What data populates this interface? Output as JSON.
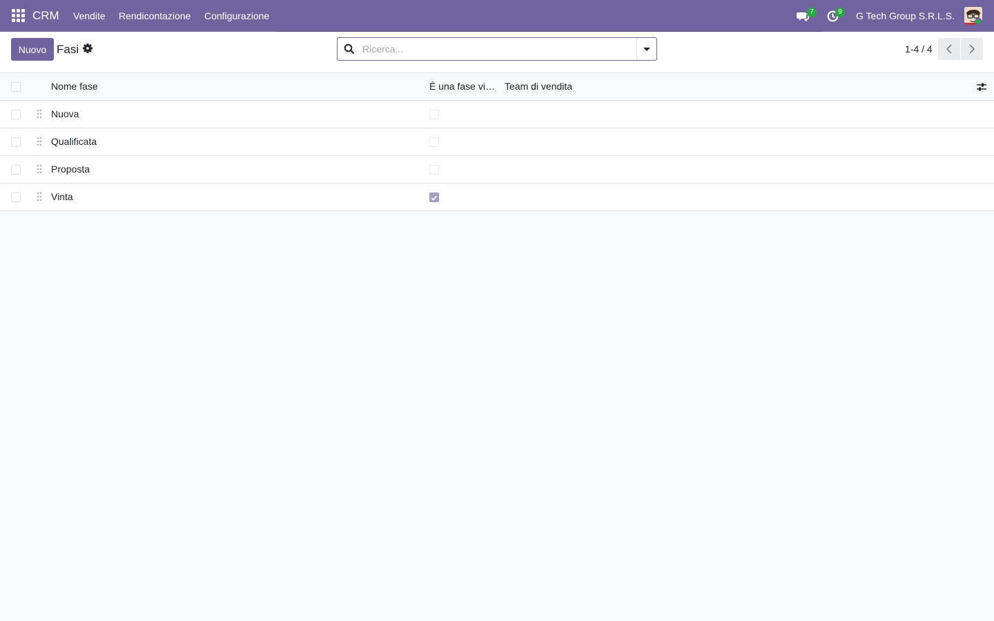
{
  "navbar": {
    "app_name": "CRM",
    "menu": [
      "Vendite",
      "Rendicontazione",
      "Configurazione"
    ],
    "messages_count": "7",
    "activities_count": "9",
    "company": "G Tech Group S.R.L.S.",
    "colors": {
      "primary": "#71639e",
      "badge": "#28a745"
    }
  },
  "control_panel": {
    "new_button": "Nuovo",
    "title": "Fasi",
    "search_placeholder": "Ricerca...",
    "pager": "1-4 / 4"
  },
  "table": {
    "columns": [
      "Nome fase",
      "È una fase vi…",
      "Team di vendita"
    ],
    "rows": [
      {
        "name": "Nuova",
        "is_won": false,
        "team": ""
      },
      {
        "name": "Qualificata",
        "is_won": false,
        "team": ""
      },
      {
        "name": "Proposta",
        "is_won": false,
        "team": ""
      },
      {
        "name": "Vinta",
        "is_won": true,
        "team": ""
      }
    ]
  },
  "icons": [
    "apps-grid-icon",
    "chat-icon",
    "clock-icon",
    "gear-icon",
    "search-icon",
    "caret-down-icon",
    "chevron-left-icon",
    "chevron-right-icon",
    "sliders-icon",
    "drag-handle-icon"
  ]
}
